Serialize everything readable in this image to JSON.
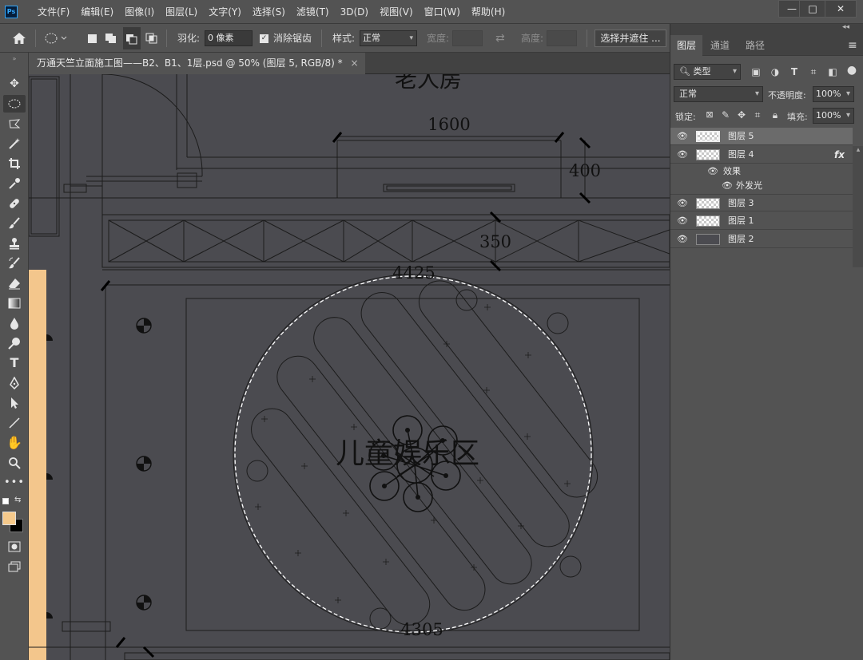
{
  "app": {
    "logo": "Ps",
    "menu": [
      "文件(F)",
      "编辑(E)",
      "图像(I)",
      "图层(L)",
      "文字(Y)",
      "选择(S)",
      "滤镜(T)",
      "3D(D)",
      "视图(V)",
      "窗口(W)",
      "帮助(H)"
    ],
    "window_controls": {
      "minimize": "—",
      "maximize": "□",
      "close": "✕"
    }
  },
  "options": {
    "home_icon": "home-icon",
    "feather_label": "羽化:",
    "feather_value": "0 像素",
    "antialias_label": "消除锯齿",
    "antialias_checked": true,
    "style_label": "样式:",
    "style_value": "正常",
    "width_label": "宽度:",
    "height_label": "高度:",
    "select_mask_button": "选择并遮住 ..."
  },
  "tools": {
    "icons": [
      "move-icon",
      "elliptical-marquee-icon",
      "lasso-icon",
      "magic-wand-icon",
      "crop-icon",
      "eyedropper-icon",
      "healing-brush-icon",
      "brush-icon",
      "clone-stamp-icon",
      "history-brush-icon",
      "eraser-icon",
      "gradient-icon",
      "blur-icon",
      "dodge-icon",
      "type-icon",
      "pen-icon",
      "path-selection-icon",
      "line-icon",
      "hand-icon",
      "zoom-icon",
      "more-tools-icon"
    ],
    "foreground_color": "#f5c98b",
    "background_color": "#000000"
  },
  "document": {
    "tab_title": "万通天竺立面施工图——B2、B1、1层.psd @ 50% (图层 5, RGB/8) *",
    "close": "×"
  },
  "drawing": {
    "room_label_top": "老人房",
    "room_label_main": "儿童娱乐区",
    "dimensions": [
      "1600",
      "400",
      "350",
      "4425",
      "4305"
    ]
  },
  "panel": {
    "tabs": [
      "图层",
      "通道",
      "路径"
    ],
    "active_tab": "图层",
    "filter_label": "类型",
    "blend_mode": "正常",
    "opacity_label": "不透明度:",
    "opacity_value": "100%",
    "lock_label": "锁定:",
    "fill_label": "填充:",
    "fill_value": "100%",
    "layers": [
      {
        "name": "图层 5",
        "selected": true,
        "fx": false
      },
      {
        "name": "图层 4",
        "selected": false,
        "fx": true
      },
      {
        "name": "图层 3",
        "selected": false,
        "fx": false
      },
      {
        "name": "图层 1",
        "selected": false,
        "fx": false
      },
      {
        "name": "图层 2",
        "selected": false,
        "fx": false
      }
    ],
    "effects_label": "效果",
    "outer_glow_label": "外发光",
    "fx_label": "fx"
  }
}
